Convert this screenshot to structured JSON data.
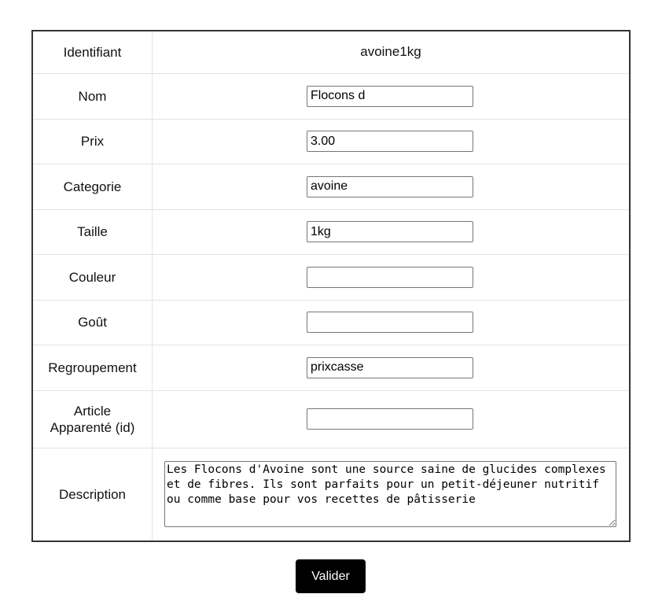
{
  "form": {
    "rows": [
      {
        "label": "Identifiant",
        "value": "avoine1kg",
        "placeholder": ""
      },
      {
        "label": "Nom",
        "value": "Flocons d",
        "placeholder": ""
      },
      {
        "label": "Prix",
        "value": "3.00",
        "placeholder": ""
      },
      {
        "label": "Categorie",
        "value": "avoine",
        "placeholder": ""
      },
      {
        "label": "Taille",
        "value": "1kg",
        "placeholder": ""
      },
      {
        "label": "Couleur",
        "value": "",
        "placeholder": ""
      },
      {
        "label": "Goût",
        "value": "",
        "placeholder": ""
      },
      {
        "label": "Regroupement",
        "value": "prixcasse",
        "placeholder": ""
      },
      {
        "label_line1": "Article",
        "label_line2": "Apparenté (id)",
        "value": "",
        "placeholder": ""
      },
      {
        "label": "Description",
        "value": "Les Flocons d'Avoine sont une source saine de glucides complexes et de fibres. Ils sont parfaits pour un petit-déjeuner nutritif\nou comme base pour vos recettes de pâtisserie"
      }
    ],
    "submit_label": "Valider"
  }
}
